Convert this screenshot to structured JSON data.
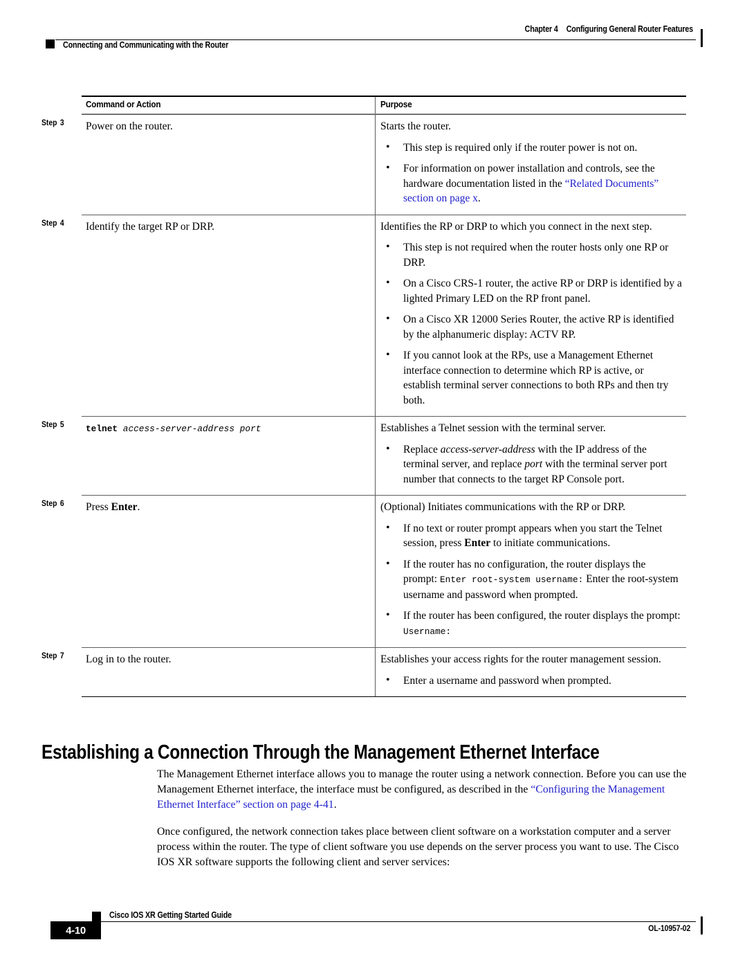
{
  "header": {
    "chapter_number": "Chapter 4",
    "chapter_title": "Configuring General Router Features",
    "section_title": "Connecting and Communicating with the Router"
  },
  "table": {
    "columns": {
      "command": "Command or Action",
      "purpose": "Purpose"
    },
    "rows": [
      {
        "step_label": "Step",
        "step_number": "3",
        "command": "Power on the router.",
        "purpose_lead": "Starts the router.",
        "purpose_bullets": [
          "This step is required only if the router power is not on.",
          "For information on power installation and controls, see the hardware documentation listed in the “Related Documents” section on page x."
        ]
      },
      {
        "step_label": "Step",
        "step_number": "4",
        "command": "Identify the target RP or DRP.",
        "purpose_lead": "Identifies the RP or DRP to which you connect in the next step.",
        "purpose_bullets": [
          "This step is not required when the router hosts only one RP or DRP.",
          "On a Cisco CRS-1 router, the active RP or DRP is identified by a lighted Primary LED on the RP front panel.",
          "On a Cisco XR 12000 Series Router, the active RP is identified by the alphanumeric display: ACTV RP.",
          "If you cannot look at the RPs, use a Management Ethernet interface connection to determine which RP is active, or establish terminal server connections to both RPs and then try both."
        ]
      },
      {
        "step_label": "Step",
        "step_number": "5",
        "command_mono_bold": "telnet",
        "command_mono_italic": "access-server-address port",
        "purpose_lead": "Establishes a Telnet session with the terminal server.",
        "purpose_bullets": [
          "Replace access-server-address with the IP address of the terminal server, and replace port with the terminal server port number that connects to the target RP Console port."
        ]
      },
      {
        "step_label": "Step",
        "step_number": "6",
        "command": "Press Enter.",
        "purpose_lead": "(Optional) Initiates communications with the RP or DRP.",
        "purpose_bullets": [
          "If no text or router prompt appears when you start the Telnet session, press Enter to initiate communications.",
          "If the router has no configuration, the router displays the prompt: Enter root-system username: Enter the root-system username and password when prompted.",
          "If the router has been configured, the router displays the prompt: Username:"
        ]
      },
      {
        "step_label": "Step",
        "step_number": "7",
        "command": "Log in to the router.",
        "purpose_lead": "Establishes your access rights for the router management session.",
        "purpose_bullets": [
          "Enter a username and password when prompted."
        ]
      }
    ]
  },
  "fragments": {
    "s3b2_pre": "For information on power installation and controls, see the hardware documentation listed in the ",
    "s3b2_link": "“Related Documents” section on page x",
    "s3b2_post": ".",
    "s5_cmd_bold": "telnet",
    "s5_cmd_italic": "access-server-address port",
    "s5b1_pre": "Replace ",
    "s5b1_ital1": "access-server-address",
    "s5b1_mid": " with the IP address of the terminal server, and replace ",
    "s5b1_ital2": "port",
    "s5b1_post": " with the terminal server port number that connects to the target RP Console port.",
    "s6_cmd_pre": "Press ",
    "s6_cmd_bold": "Enter",
    "s6_cmd_post": ".",
    "s6b1_pre": "If no text or router prompt appears when you start the Telnet session, press ",
    "s6b1_bold": "Enter",
    "s6b1_post": " to initiate communications.",
    "s6b2_pre": "If the router has no configuration, the router displays the prompt: ",
    "s6b2_mono": "Enter root-system username:",
    "s6b2_post": " Enter the root-system username and password when prompted.",
    "s6b3_pre": "If the router has been configured, the router displays the prompt: ",
    "s6b3_mono": "Username:",
    "bullet_glyph": "•"
  },
  "section": {
    "heading": "Establishing a Connection Through the Management Ethernet Interface",
    "paragraph_1_pre": "The Management Ethernet interface allows you to manage the router using a network connection. Before you can use the Management Ethernet interface, the interface must be configured, as described in the ",
    "paragraph_1_link": "“Configuring the Management Ethernet Interface” section on page 4-41",
    "paragraph_1_post": ".",
    "paragraph_2": "Once configured, the network connection takes place between client software on a workstation computer and a server process within the router. The type of client software you use depends on the server process you want to use. The Cisco IOS XR software supports the following client and server services:"
  },
  "footer": {
    "guide_title": "Cisco IOS XR Getting Started Guide",
    "page_number": "4-10",
    "document_id": "OL-10957-02"
  },
  "colors": {
    "link": "#2222cc",
    "text": "#000000",
    "rule_dark": "#000000",
    "rule_light": "#5d5d5d"
  }
}
